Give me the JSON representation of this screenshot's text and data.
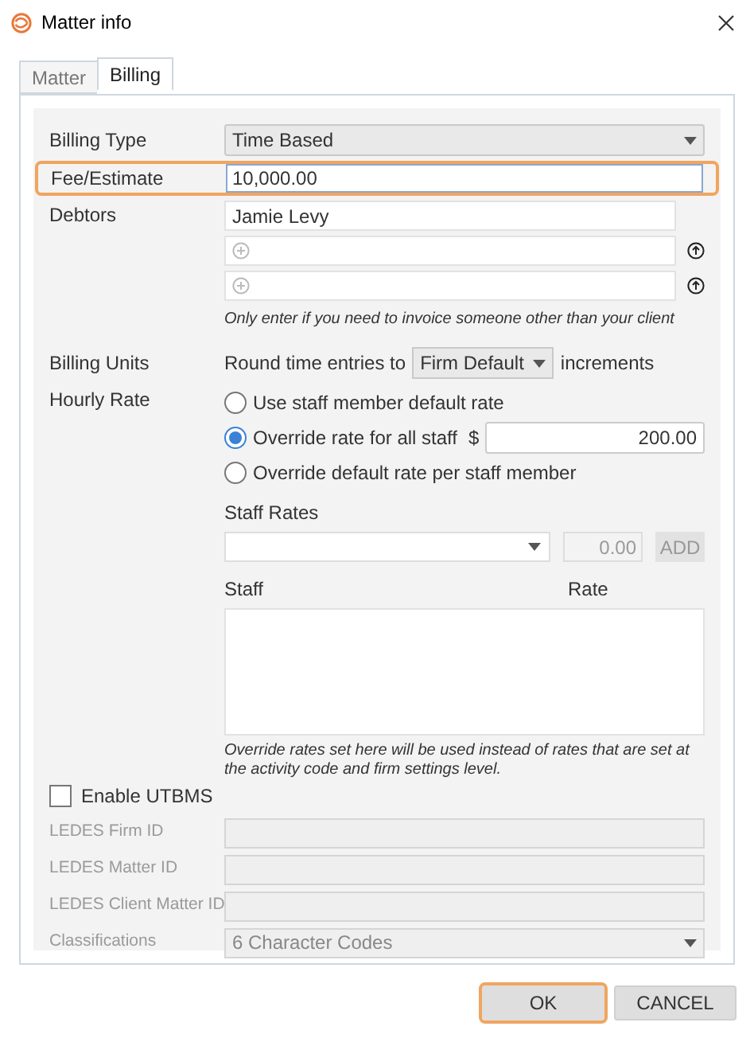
{
  "window": {
    "title": "Matter info"
  },
  "tabs": [
    {
      "label": "Matter",
      "selected": false
    },
    {
      "label": "Billing",
      "selected": true
    }
  ],
  "billing_type": {
    "label": "Billing Type",
    "value": "Time Based"
  },
  "fee_estimate": {
    "label": "Fee/Estimate",
    "value": "10,000.00",
    "highlighted": true
  },
  "debtors": {
    "label": "Debtors",
    "entries": [
      {
        "value": "Jamie Levy",
        "kind": "name"
      },
      {
        "kind": "add"
      },
      {
        "kind": "add"
      }
    ],
    "note": "Only enter if you need to invoice someone other than your client"
  },
  "billing_units": {
    "label": "Billing Units",
    "prefix": "Round time entries to",
    "value": "Firm Default",
    "suffix": "increments"
  },
  "hourly_rate": {
    "label": "Hourly Rate",
    "options": [
      {
        "label": "Use staff member default rate",
        "selected": false
      },
      {
        "label": "Override rate for all staff",
        "selected": true,
        "currency": "$",
        "value": "200.00"
      },
      {
        "label": "Override default rate per staff member",
        "selected": false
      }
    ]
  },
  "staff_rates": {
    "title": "Staff Rates",
    "rate_value": "0.00",
    "add_button": "ADD",
    "columns": [
      "Staff",
      "Rate"
    ],
    "note": "Override rates set here will be used instead of rates that are set at the activity code and firm settings level."
  },
  "utbms": {
    "label": "Enable UTBMS",
    "checked": false
  },
  "ledes_fields": [
    {
      "label": "LEDES Firm ID",
      "kind": "text",
      "disabled": true
    },
    {
      "label": "LEDES Matter ID",
      "kind": "text",
      "disabled": true
    },
    {
      "label": "LEDES Client Matter ID",
      "kind": "text",
      "disabled": true
    },
    {
      "label": "Classifications",
      "kind": "select",
      "value": "6 Character Codes",
      "disabled": true
    }
  ],
  "buttons": [
    {
      "label": "OK",
      "highlighted": true
    },
    {
      "label": "CANCEL",
      "highlighted": false
    }
  ]
}
